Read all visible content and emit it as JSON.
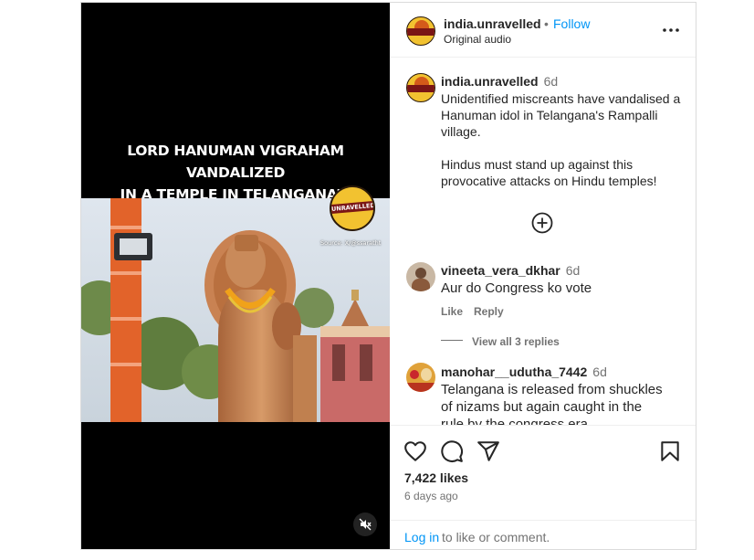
{
  "media": {
    "headline_line1": "LORD HANUMAN VIGRAHAM VANDALIZED",
    "headline_line2": "IN A TEMPLE IN TELANGANA’S RAMPALLI",
    "badge_text": "UNRAVELLED",
    "source_credit": "Source: X/@ssaratht"
  },
  "post": {
    "username": "india.unravelled",
    "follow_sep": "•",
    "follow_label": "Follow",
    "audio": "Original audio",
    "caption": {
      "username": "india.unravelled",
      "time": "6d",
      "line1": "Unidentified miscreants have vandalised a",
      "line2": "Hanuman idol in Telangana's Rampalli",
      "line3": "village.",
      "line4": "Hindus must stand up against this",
      "line5": "provocative attacks on Hindu temples!"
    }
  },
  "comments": [
    {
      "username": "vineeta_vera_dkhar",
      "time": "6d",
      "text": "Aur do Congress ko vote",
      "like_label": "Like",
      "reply_label": "Reply",
      "view_replies": "View all 3 replies"
    },
    {
      "username": "manohar__udutha_7442",
      "time": "6d",
      "line1": "Telangana is released from shuckles",
      "line2": "of nizams but again caught in the",
      "line3": "rule by the congress era"
    }
  ],
  "footer": {
    "likes": "7,422 likes",
    "date": "6 days ago",
    "login_link": "Log in",
    "login_suffix": "to like or comment."
  },
  "icons": [
    "mute-icon",
    "more-options-icon",
    "add-circle-icon",
    "heart-icon",
    "comment-icon",
    "share-icon",
    "bookmark-icon"
  ],
  "colors": {
    "link_blue": "#0095f6",
    "muted_gray": "#737373",
    "text": "#262626",
    "badge_yellow": "#f2c230",
    "badge_red": "#7a1515"
  }
}
